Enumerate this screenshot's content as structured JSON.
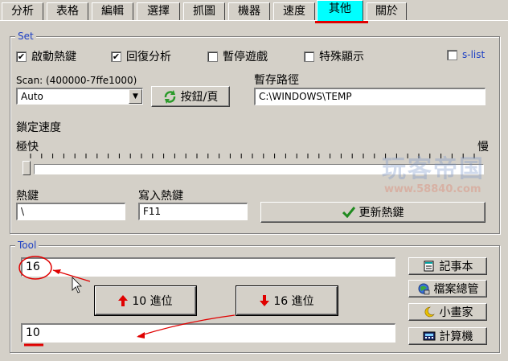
{
  "tabs": [
    {
      "label": "分析"
    },
    {
      "label": "表格"
    },
    {
      "label": "編輯"
    },
    {
      "label": "選擇"
    },
    {
      "label": "抓圖"
    },
    {
      "label": "機器"
    },
    {
      "label": "速度"
    },
    {
      "label": "其他",
      "active": true
    },
    {
      "label": "關於"
    }
  ],
  "set_group": {
    "legend": "Set",
    "checkboxes": [
      {
        "label": "啟動熱鍵",
        "checked": true
      },
      {
        "label": "回復分析",
        "checked": true
      },
      {
        "label": "暫停遊戲",
        "checked": false
      },
      {
        "label": "特殊顯示",
        "checked": false
      },
      {
        "label": "s-list",
        "checked": false
      }
    ],
    "scan_label": "Scan: (400000-7ffe1000)",
    "scan_value": "Auto",
    "page_button": "按鈕/頁",
    "temp_path_label": "暫存路徑",
    "temp_path_value": "C:\\WINDOWS\\TEMP",
    "lock_speed_label": "鎖定速度",
    "speed_fast": "極快",
    "speed_slow": "慢",
    "hotkey_label": "熱鍵",
    "hotkey_value": "\\",
    "write_hotkey_label": "寫入熱鍵",
    "write_hotkey_value": "F11",
    "update_hotkey_button": "更新熱鍵"
  },
  "tool_group": {
    "legend": "Tool",
    "hex_input_value": "16",
    "dec_input_value": "10",
    "to_base10_button": "10 進位",
    "to_base16_button": "16 進位",
    "notepad_button": "記事本",
    "file_manager_button": "檔案總管",
    "paint_button": "小畫家",
    "calculator_button": "計算機"
  },
  "watermark": {
    "title": "玩客帝国",
    "url": "www.58840.com"
  },
  "colors": {
    "face": "#d4d0c8",
    "active_tab": "#00ffff",
    "annotation_red": "#e00000",
    "legend_blue": "#1c3fc4"
  }
}
